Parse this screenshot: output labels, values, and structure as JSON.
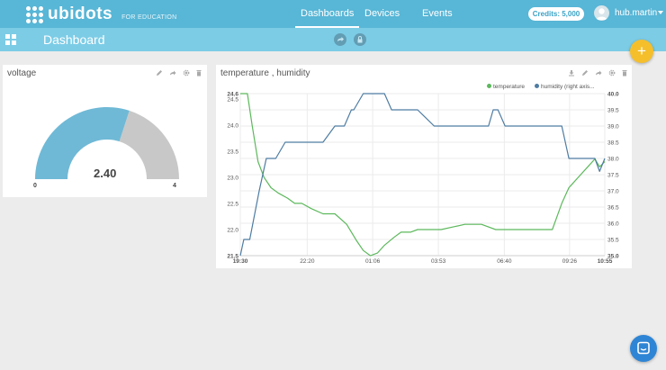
{
  "brand": {
    "name": "ubidots",
    "subtitle": "FOR EDUCATION"
  },
  "nav": {
    "items": [
      "Dashboards",
      "Devices",
      "Events"
    ],
    "active": 0
  },
  "credits": "Credits: 5,000",
  "user": {
    "name": "hub.martin"
  },
  "page": {
    "title": "Dashboard"
  },
  "fab_label": "+",
  "widgets": {
    "voltage": {
      "title": "voltage",
      "value": "2.40",
      "min_label": "0",
      "max_label": "4",
      "fill_fraction": 0.6,
      "fill_color": "#6fb9d6",
      "track_color": "#c8c8c8"
    },
    "chart": {
      "title": "temperature , humidity",
      "legend": {
        "temperature": "temperature",
        "humidity": "humidity (right axis..."
      }
    }
  },
  "chart_data": {
    "type": "line",
    "title": "temperature , humidity",
    "xlabel": "",
    "ylabel": "",
    "x_ticks": [
      "19:30",
      "22:20",
      "01:06",
      "03:53",
      "06:40",
      "09:26",
      "10:55"
    ],
    "x_tick_pos": [
      0,
      2.83,
      5.6,
      8.38,
      11.17,
      13.93,
      15.42
    ],
    "xlim": [
      0,
      15.42
    ],
    "y_left": {
      "ylim": [
        21.5,
        24.6
      ],
      "ticks": [
        "21.5",
        "22.0",
        "22.5",
        "23.0",
        "23.5",
        "24.0",
        "24.5",
        "24.6"
      ],
      "tick_values": [
        21.5,
        22.0,
        22.5,
        23.0,
        23.5,
        24.0,
        24.5,
        24.6
      ]
    },
    "y_right": {
      "ylim": [
        35.0,
        40.0
      ],
      "ticks": [
        "35.0",
        "35.5",
        "36.0",
        "36.5",
        "37.0",
        "37.5",
        "38.0",
        "38.5",
        "39.0",
        "39.5",
        "40.0"
      ],
      "tick_values": [
        35.0,
        35.5,
        36.0,
        36.5,
        37.0,
        37.5,
        38.0,
        38.5,
        39.0,
        39.5,
        40.0
      ]
    },
    "grid": true,
    "legend_position": "top-right",
    "series": [
      {
        "name": "temperature",
        "axis": "left",
        "color": "#5cb85c",
        "x": [
          0,
          0.3,
          0.5,
          0.75,
          1.0,
          1.3,
          1.6,
          2.0,
          2.3,
          2.6,
          3.0,
          3.5,
          4.0,
          4.5,
          4.9,
          5.2,
          5.5,
          5.8,
          6.1,
          6.5,
          6.8,
          7.2,
          7.5,
          8.0,
          8.5,
          9.0,
          9.5,
          10.2,
          10.8,
          11.5,
          12.2,
          12.8,
          13.2,
          13.6,
          13.9,
          14.3,
          14.7,
          15.0,
          15.2,
          15.42
        ],
        "y": [
          24.6,
          24.6,
          24.0,
          23.3,
          23.0,
          22.8,
          22.7,
          22.6,
          22.5,
          22.5,
          22.4,
          22.3,
          22.3,
          22.1,
          21.8,
          21.6,
          21.5,
          21.55,
          21.7,
          21.85,
          21.95,
          21.95,
          22.0,
          22.0,
          22.0,
          22.05,
          22.1,
          22.1,
          22.0,
          22.0,
          22.0,
          22.0,
          22.0,
          22.5,
          22.8,
          23.0,
          23.2,
          23.35,
          23.2,
          23.3
        ]
      },
      {
        "name": "humidity (right axis...",
        "axis": "right",
        "color": "#4e7ca2",
        "x": [
          0,
          0.15,
          0.4,
          0.8,
          1.1,
          1.5,
          1.9,
          2.5,
          3.0,
          3.5,
          4.0,
          4.4,
          4.7,
          4.8,
          5.2,
          5.7,
          6.1,
          6.4,
          6.9,
          7.5,
          8.2,
          9.0,
          9.8,
          10.5,
          10.7,
          10.9,
          11.2,
          11.8,
          12.5,
          12.9,
          13.2,
          13.6,
          13.9,
          14.3,
          14.7,
          15.0,
          15.2,
          15.42
        ],
        "y": [
          35.0,
          35.5,
          35.5,
          37.0,
          38.0,
          38.0,
          38.5,
          38.5,
          38.5,
          38.5,
          39.0,
          39.0,
          39.5,
          39.5,
          40.0,
          40.0,
          40.0,
          39.5,
          39.5,
          39.5,
          39.0,
          39.0,
          39.0,
          39.0,
          39.5,
          39.5,
          39.0,
          39.0,
          39.0,
          39.0,
          39.0,
          39.0,
          38.0,
          38.0,
          38.0,
          38.0,
          37.6,
          38.0
        ]
      }
    ]
  }
}
